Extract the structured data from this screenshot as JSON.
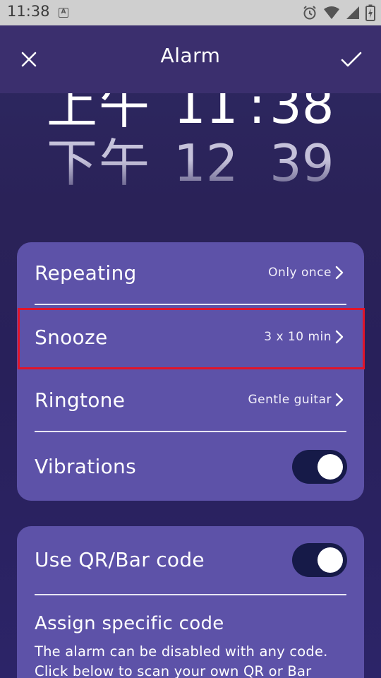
{
  "status_bar": {
    "time": "11:38",
    "icons": [
      "a-notification-icon",
      "alarm-clock-icon",
      "wifi-icon",
      "signal-icon",
      "battery-charging-icon"
    ]
  },
  "header": {
    "title": "Alarm",
    "close_icon": "close-icon",
    "confirm_icon": "checkmark-icon"
  },
  "time_picker": {
    "current": {
      "ampm": "上午",
      "hour": "11",
      "colon": ":",
      "minute": "38"
    },
    "next": {
      "ampm": "下午",
      "hour": "12",
      "minute": "39"
    }
  },
  "settings": {
    "repeating": {
      "label": "Repeating",
      "value": "Only once"
    },
    "snooze": {
      "label": "Snooze",
      "value": "3 x 10 min"
    },
    "ringtone": {
      "label": "Ringtone",
      "value": "Gentle guitar"
    },
    "vibrations": {
      "label": "Vibrations",
      "enabled": true
    }
  },
  "code_section": {
    "use_code": {
      "label": "Use QR/Bar code",
      "enabled": true
    },
    "assign_title": "Assign specific code",
    "assign_description": "The alarm can be disabled with any code. Click below to scan your own QR or Bar"
  },
  "colors": {
    "background": "#2a2258",
    "card": "#5d52a8",
    "toggle_track": "#161a48",
    "highlight": "#e0152a"
  }
}
